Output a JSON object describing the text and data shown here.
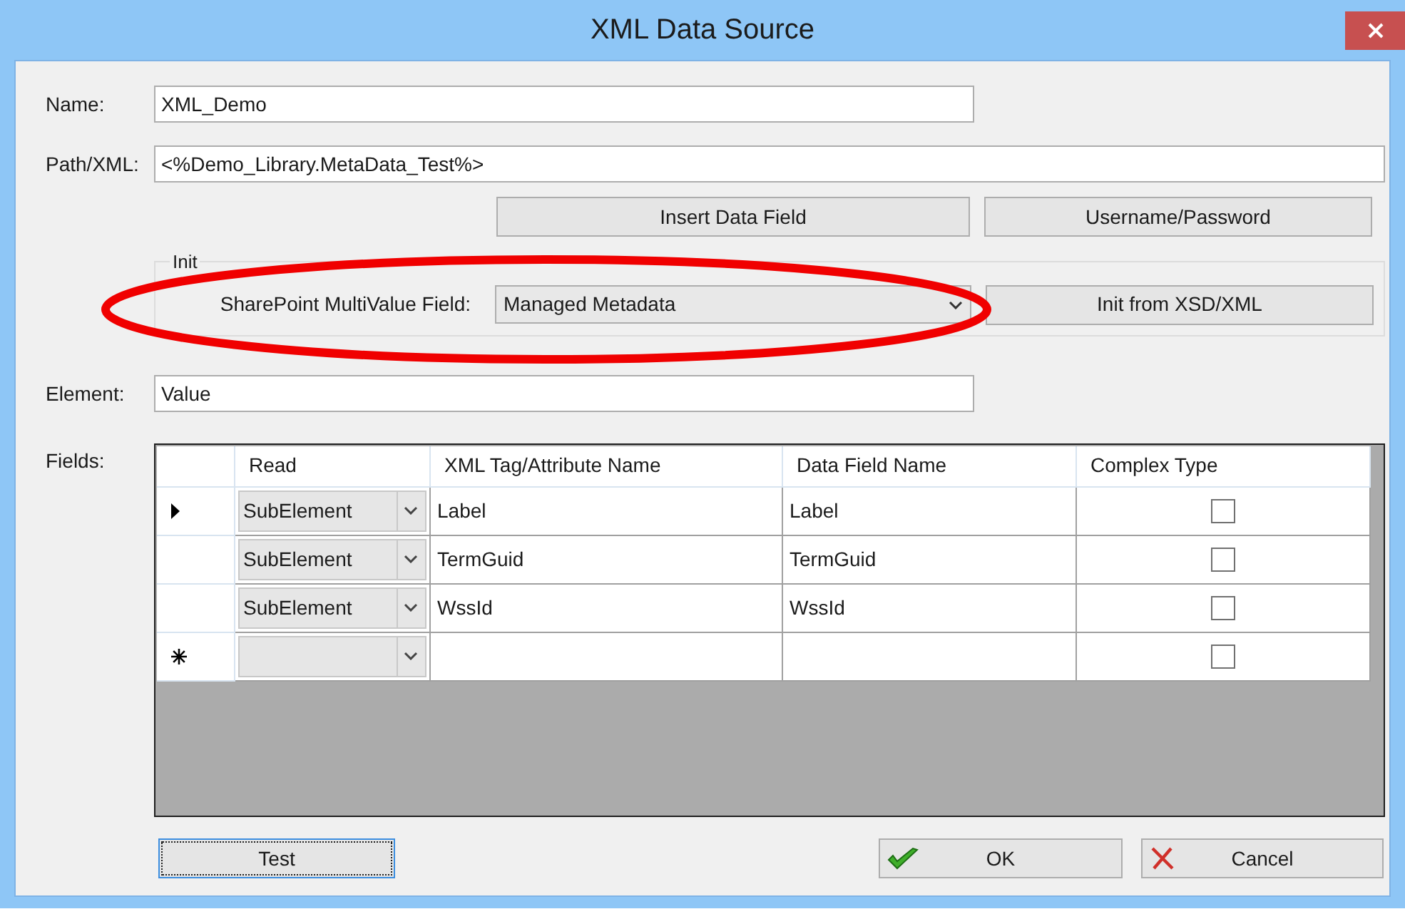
{
  "window": {
    "title": "XML Data Source"
  },
  "name": {
    "label": "Name:",
    "value": "XML_Demo"
  },
  "path": {
    "label": "Path/XML:",
    "value": "<%Demo_Library.MetaData_Test%>"
  },
  "path_buttons": [
    "Insert Data Field",
    "Username/Password"
  ],
  "init": {
    "title": "Init",
    "multivalue_label": "SharePoint MultiValue Field:",
    "multivalue_value": "Managed Metadata",
    "button": "Init from XSD/XML"
  },
  "element": {
    "label": "Element:",
    "value": "Value"
  },
  "fields": {
    "label": "Fields:",
    "columns": [
      "Read",
      "XML Tag/Attribute Name",
      "Data Field Name",
      "Complex Type"
    ],
    "rows": [
      {
        "kind": "data",
        "current": true,
        "read": "SubElement",
        "xml_tag": "Label",
        "data_field": "Label",
        "complex_type": false
      },
      {
        "kind": "data",
        "current": false,
        "read": "SubElement",
        "xml_tag": "TermGuid",
        "data_field": "TermGuid",
        "complex_type": false
      },
      {
        "kind": "data",
        "current": false,
        "read": "SubElement",
        "xml_tag": "WssId",
        "data_field": "WssId",
        "complex_type": false
      },
      {
        "kind": "new",
        "current": false,
        "complex_type": false
      }
    ]
  },
  "buttons": [
    {
      "kind": "test",
      "label": "Test",
      "focused": true
    },
    {
      "kind": "ok",
      "label": "OK",
      "focused": false
    },
    {
      "kind": "cancel",
      "label": "Cancel",
      "focused": false
    }
  ]
}
